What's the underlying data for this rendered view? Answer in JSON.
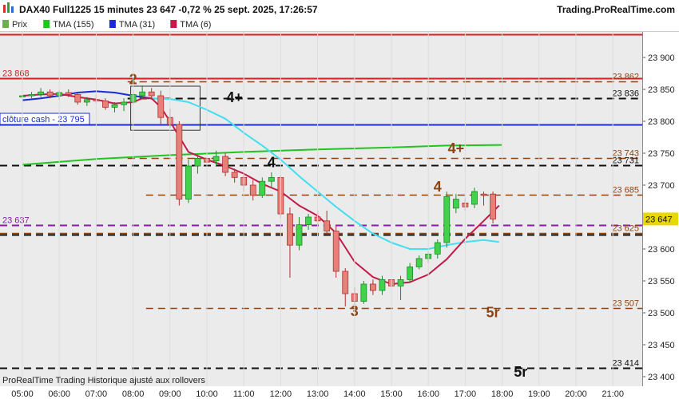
{
  "header": {
    "title": "DAX40 Full1225 15 minutes 23 647 -0,72 % 25 sept. 2025, 17:26:57",
    "site": "Trading.ProRealTime.com"
  },
  "legend": [
    {
      "label": "Prix",
      "color": "#6ab04c"
    },
    {
      "label": "TMA (155)",
      "color": "#22c422"
    },
    {
      "label": "TMA (31)",
      "color": "#1a2bd6"
    },
    {
      "label": "TMA (6)",
      "color": "#c41a4a"
    }
  ],
  "footer": "ProRealTime Trading  Historique ajusté aux rollovers",
  "chart_data": {
    "type": "candlestick",
    "ylim": [
      23385,
      23940
    ],
    "xlim": [
      "05:00",
      "21:30"
    ],
    "y_ticks": [
      23400,
      23450,
      23500,
      23550,
      23600,
      23650,
      23700,
      23750,
      23800,
      23850,
      23900
    ],
    "y_tick_labels": [
      "23 400",
      "23 450",
      "23 500",
      "23 550",
      "23 600",
      "23 650",
      "23 700",
      "23 750",
      "23 800",
      "23 850",
      "23 900"
    ],
    "x_ticks": [
      "05:00",
      "06:00",
      "07:00",
      "08:00",
      "09:00",
      "10:00",
      "11:00",
      "12:00",
      "13:00",
      "14:00",
      "15:00",
      "16:00",
      "17:00",
      "18:00",
      "19:00",
      "20:00",
      "21:00"
    ],
    "candles": [
      {
        "t": "05:00",
        "o": 23838,
        "h": 23844,
        "l": 23834,
        "c": 23840
      },
      {
        "t": "05:15",
        "o": 23840,
        "h": 23846,
        "l": 23836,
        "c": 23842
      },
      {
        "t": "05:30",
        "o": 23842,
        "h": 23852,
        "l": 23838,
        "c": 23846
      },
      {
        "t": "05:45",
        "o": 23846,
        "h": 23850,
        "l": 23836,
        "c": 23840
      },
      {
        "t": "06:00",
        "o": 23840,
        "h": 23848,
        "l": 23834,
        "c": 23845
      },
      {
        "t": "06:15",
        "o": 23845,
        "h": 23850,
        "l": 23838,
        "c": 23842
      },
      {
        "t": "06:30",
        "o": 23842,
        "h": 23846,
        "l": 23826,
        "c": 23830
      },
      {
        "t": "06:45",
        "o": 23830,
        "h": 23838,
        "l": 23824,
        "c": 23834
      },
      {
        "t": "07:00",
        "o": 23834,
        "h": 23842,
        "l": 23828,
        "c": 23832
      },
      {
        "t": "07:15",
        "o": 23832,
        "h": 23836,
        "l": 23818,
        "c": 23822
      },
      {
        "t": "07:30",
        "o": 23822,
        "h": 23830,
        "l": 23814,
        "c": 23826
      },
      {
        "t": "07:45",
        "o": 23826,
        "h": 23836,
        "l": 23816,
        "c": 23830
      },
      {
        "t": "08:00",
        "o": 23830,
        "h": 23848,
        "l": 23826,
        "c": 23842
      },
      {
        "t": "08:15",
        "o": 23840,
        "h": 23856,
        "l": 23836,
        "c": 23846
      },
      {
        "t": "08:30",
        "o": 23846,
        "h": 23852,
        "l": 23834,
        "c": 23840
      },
      {
        "t": "08:45",
        "o": 23840,
        "h": 23848,
        "l": 23796,
        "c": 23806
      },
      {
        "t": "09:00",
        "o": 23806,
        "h": 23820,
        "l": 23790,
        "c": 23795
      },
      {
        "t": "09:15",
        "o": 23795,
        "h": 23800,
        "l": 23668,
        "c": 23678
      },
      {
        "t": "09:30",
        "o": 23678,
        "h": 23740,
        "l": 23672,
        "c": 23730
      },
      {
        "t": "09:45",
        "o": 23730,
        "h": 23748,
        "l": 23718,
        "c": 23742
      },
      {
        "t": "10:00",
        "o": 23742,
        "h": 23750,
        "l": 23732,
        "c": 23736
      },
      {
        "t": "10:15",
        "o": 23738,
        "h": 23754,
        "l": 23730,
        "c": 23745
      },
      {
        "t": "10:30",
        "o": 23745,
        "h": 23750,
        "l": 23714,
        "c": 23720
      },
      {
        "t": "10:45",
        "o": 23720,
        "h": 23726,
        "l": 23704,
        "c": 23712
      },
      {
        "t": "11:00",
        "o": 23712,
        "h": 23716,
        "l": 23690,
        "c": 23700
      },
      {
        "t": "11:15",
        "o": 23700,
        "h": 23708,
        "l": 23676,
        "c": 23684
      },
      {
        "t": "11:30",
        "o": 23684,
        "h": 23712,
        "l": 23680,
        "c": 23706
      },
      {
        "t": "11:45",
        "o": 23706,
        "h": 23720,
        "l": 23696,
        "c": 23712
      },
      {
        "t": "12:00",
        "o": 23712,
        "h": 23716,
        "l": 23648,
        "c": 23655
      },
      {
        "t": "12:15",
        "o": 23655,
        "h": 23665,
        "l": 23555,
        "c": 23606
      },
      {
        "t": "12:30",
        "o": 23606,
        "h": 23650,
        "l": 23598,
        "c": 23638
      },
      {
        "t": "12:45",
        "o": 23638,
        "h": 23655,
        "l": 23630,
        "c": 23650
      },
      {
        "t": "13:00",
        "o": 23650,
        "h": 23660,
        "l": 23636,
        "c": 23644
      },
      {
        "t": "13:15",
        "o": 23644,
        "h": 23660,
        "l": 23624,
        "c": 23628
      },
      {
        "t": "13:30",
        "o": 23628,
        "h": 23636,
        "l": 23555,
        "c": 23565
      },
      {
        "t": "13:45",
        "o": 23565,
        "h": 23570,
        "l": 23510,
        "c": 23530
      },
      {
        "t": "14:00",
        "o": 23530,
        "h": 23540,
        "l": 23512,
        "c": 23518
      },
      {
        "t": "14:15",
        "o": 23518,
        "h": 23550,
        "l": 23514,
        "c": 23545
      },
      {
        "t": "14:30",
        "o": 23545,
        "h": 23552,
        "l": 23528,
        "c": 23535
      },
      {
        "t": "14:45",
        "o": 23535,
        "h": 23558,
        "l": 23528,
        "c": 23552
      },
      {
        "t": "15:00",
        "o": 23552,
        "h": 23558,
        "l": 23536,
        "c": 23542
      },
      {
        "t": "15:15",
        "o": 23542,
        "h": 23558,
        "l": 23520,
        "c": 23552
      },
      {
        "t": "15:30",
        "o": 23552,
        "h": 23578,
        "l": 23548,
        "c": 23572
      },
      {
        "t": "15:45",
        "o": 23572,
        "h": 23590,
        "l": 23568,
        "c": 23585
      },
      {
        "t": "16:00",
        "o": 23585,
        "h": 23596,
        "l": 23578,
        "c": 23592
      },
      {
        "t": "16:15",
        "o": 23592,
        "h": 23615,
        "l": 23585,
        "c": 23610
      },
      {
        "t": "16:30",
        "o": 23610,
        "h": 23690,
        "l": 23602,
        "c": 23682
      },
      {
        "t": "16:45",
        "o": 23664,
        "h": 23686,
        "l": 23656,
        "c": 23678
      },
      {
        "t": "17:00",
        "o": 23672,
        "h": 23680,
        "l": 23660,
        "c": 23666
      },
      {
        "t": "17:15",
        "o": 23670,
        "h": 23696,
        "l": 23664,
        "c": 23690
      },
      {
        "t": "17:30",
        "o": 23686,
        "h": 23690,
        "l": 23668,
        "c": 23684
      },
      {
        "t": "17:45",
        "o": 23686,
        "h": 23690,
        "l": 23640,
        "c": 23647
      }
    ],
    "series": [
      {
        "name": "TMA (155)",
        "color": "#22c422",
        "points": [
          [
            "05:00",
            23732
          ],
          [
            "07:00",
            23741
          ],
          [
            "09:00",
            23747
          ],
          [
            "11:00",
            23752
          ],
          [
            "13:00",
            23756
          ],
          [
            "15:00",
            23759
          ],
          [
            "16:30",
            23762
          ],
          [
            "18:00",
            23763
          ]
        ]
      },
      {
        "name": "TMA (31)",
        "color": "#1a2bd6",
        "points": [
          [
            "05:00",
            23833
          ],
          [
            "05:30",
            23836
          ],
          [
            "06:00",
            23840
          ],
          [
            "06:30",
            23845
          ],
          [
            "07:00",
            23847
          ],
          [
            "07:30",
            23845
          ],
          [
            "08:00",
            23840
          ],
          [
            "08:30",
            23836
          ]
        ]
      },
      {
        "name": "TMA (31)",
        "color": "#40e0f0",
        "points": [
          [
            "08:30",
            23836
          ],
          [
            "09:00",
            23835
          ],
          [
            "09:30",
            23830
          ],
          [
            "10:00",
            23818
          ],
          [
            "10:30",
            23804
          ],
          [
            "11:00",
            23782
          ],
          [
            "11:30",
            23762
          ],
          [
            "12:00",
            23740
          ],
          [
            "12:30",
            23714
          ],
          [
            "13:00",
            23690
          ],
          [
            "13:30",
            23666
          ],
          [
            "14:00",
            23644
          ],
          [
            "14:30",
            23624
          ],
          [
            "15:00",
            23610
          ],
          [
            "15:30",
            23600
          ],
          [
            "16:00",
            23600
          ],
          [
            "16:30",
            23606
          ],
          [
            "17:00",
            23611
          ],
          [
            "17:30",
            23614
          ],
          [
            "17:55",
            23611
          ]
        ]
      },
      {
        "name": "TMA (6)",
        "color": "#c41a4a",
        "points": [
          [
            "05:00",
            23840
          ],
          [
            "05:30",
            23842
          ],
          [
            "06:00",
            23843
          ],
          [
            "06:30",
            23838
          ],
          [
            "07:00",
            23834
          ],
          [
            "07:30",
            23828
          ],
          [
            "08:00",
            23830
          ],
          [
            "08:15",
            23836
          ],
          [
            "08:30",
            23836
          ],
          [
            "08:45",
            23822
          ],
          [
            "09:00",
            23800
          ],
          [
            "09:30",
            23752
          ],
          [
            "10:00",
            23740
          ],
          [
            "10:30",
            23730
          ],
          [
            "11:00",
            23718
          ],
          [
            "11:30",
            23702
          ],
          [
            "12:00",
            23690
          ],
          [
            "12:30",
            23668
          ],
          [
            "13:00",
            23652
          ],
          [
            "13:30",
            23625
          ],
          [
            "14:00",
            23580
          ],
          [
            "14:30",
            23556
          ],
          [
            "15:00",
            23545
          ],
          [
            "15:30",
            23548
          ],
          [
            "16:00",
            23560
          ],
          [
            "16:30",
            23584
          ],
          [
            "17:00",
            23616
          ],
          [
            "17:30",
            23644
          ],
          [
            "17:55",
            23668
          ]
        ]
      }
    ],
    "hlines": [
      {
        "value": 23868,
        "color": "#d42020",
        "style": "solid",
        "width": 2,
        "label_left": "23 868",
        "label_right": "",
        "x_start": "05:00"
      },
      {
        "value": 23936,
        "color": "#d42020",
        "style": "solid",
        "width": 2,
        "label_left": "",
        "label_right": "",
        "x_start": "05:00"
      },
      {
        "value": 23862,
        "color": "#8b4513",
        "style": "dashed",
        "width": 1.5,
        "label_left": "",
        "label_right": "23 862",
        "x_start": "08:30"
      },
      {
        "value": 23836,
        "color": "#111111",
        "style": "dashed",
        "width": 2,
        "label_left": "",
        "label_right": "23 836",
        "x_start": "08:30"
      },
      {
        "value": 23795,
        "color": "#1a2bd6",
        "style": "solid",
        "width": 2,
        "label_left": "",
        "label_right": "",
        "x_start": "05:00"
      },
      {
        "value": 23743,
        "color": "#8b4513",
        "style": "dashed",
        "width": 1.5,
        "label_left": "",
        "label_right": "23 743",
        "x_start": "08:30"
      },
      {
        "value": 23731,
        "color": "#111111",
        "style": "dashed",
        "width": 2,
        "label_left": "",
        "label_right": "23 731",
        "x_start": "05:00"
      },
      {
        "value": 23685,
        "color": "#8b4513",
        "style": "dashed",
        "width": 1.5,
        "label_left": "",
        "label_right": "23 685",
        "x_start": "09:00"
      },
      {
        "value": 23637,
        "color": "#8a1aa8",
        "style": "dashed",
        "width": 2,
        "label_left": "23 637",
        "label_right": "",
        "x_start": "05:00"
      },
      {
        "value": 23625,
        "color": "#8b4513",
        "style": "dashed",
        "width": 1.5,
        "label_left": "",
        "label_right": "23 625",
        "x_start": "05:00"
      },
      {
        "value": 23623,
        "color": "#111111",
        "style": "dashed",
        "width": 2,
        "label_left": "",
        "label_right": "",
        "x_start": "05:00"
      },
      {
        "value": 23507,
        "color": "#8b4513",
        "style": "dashed",
        "width": 1.5,
        "label_left": "",
        "label_right": "23 507",
        "x_start": "09:00"
      },
      {
        "value": 23414,
        "color": "#111111",
        "style": "dashed",
        "width": 2,
        "label_left": "",
        "label_right": "23 414",
        "x_start": "05:00"
      }
    ],
    "cash_close": {
      "label": "clôture cash -  23 795",
      "value": 23795
    },
    "annotations": [
      {
        "text": "2",
        "t": "08:00",
        "y": 23858,
        "color": "#8b4513",
        "size": 18
      },
      {
        "text": "4+",
        "t": "10:45",
        "y": 23830,
        "color": "#111111",
        "size": 18
      },
      {
        "text": "4",
        "t": "11:45",
        "y": 23728,
        "color": "#111111",
        "size": 18
      },
      {
        "text": "4+",
        "t": "16:45",
        "y": 23750,
        "color": "#8b4513",
        "size": 18
      },
      {
        "text": "4",
        "t": "16:15",
        "y": 23690,
        "color": "#8b4513",
        "size": 18
      },
      {
        "text": "3",
        "t": "14:00",
        "y": 23495,
        "color": "#8b4513",
        "size": 18
      },
      {
        "text": "5r",
        "t": "17:45",
        "y": 23493,
        "color": "#8b4513",
        "size": 18
      },
      {
        "text": "5r",
        "t": "18:30",
        "y": 23400,
        "color": "#111111",
        "size": 18
      }
    ],
    "box": {
      "t1": "08:00",
      "t2": "09:45",
      "y1": 23855,
      "y2": 23786
    },
    "current_price": {
      "label": "23 647",
      "value": 23647,
      "color": "#e8d800"
    }
  }
}
